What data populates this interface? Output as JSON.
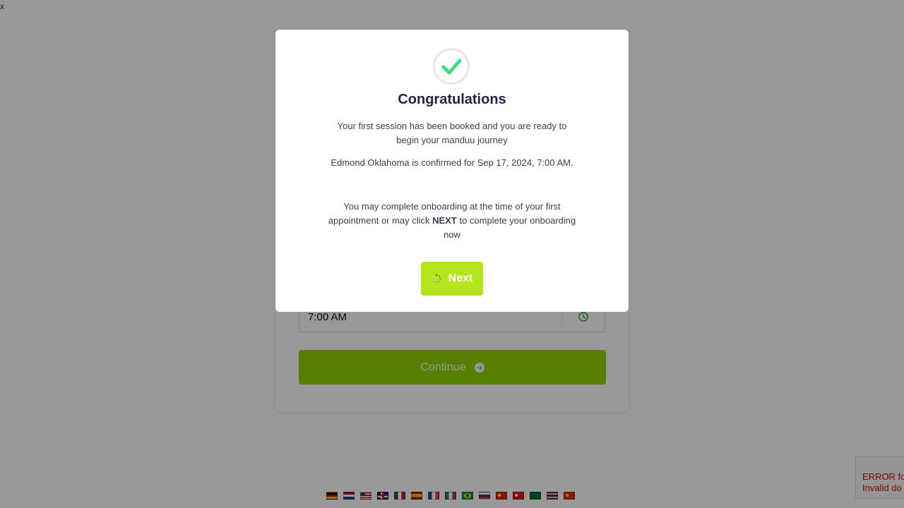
{
  "page": {
    "close_label": "x"
  },
  "form": {
    "time_value": "7:00 AM",
    "continue_label": "Continue"
  },
  "modal": {
    "title": "Congratulations",
    "message1": "Your first session has been booked and you are ready to begin your manduu journey",
    "message2": "Edmond Oklahoma is confirmed for Sep 17, 2024, 7:00 AM.",
    "message3_before": "You may complete onboarding at the time of your first appointment or may click ",
    "message3_bold": "NEXT",
    "message3_after": " to complete your onboarding now",
    "next_label": "Next"
  },
  "recaptcha": {
    "line1": "ERROR fo",
    "line2": "Invalid do"
  },
  "flags": [
    {
      "name": "flag-de",
      "colors": [
        "#000000",
        "#dd0000",
        "#ffce00"
      ],
      "style": "h3"
    },
    {
      "name": "flag-nl",
      "colors": [
        "#ae1c28",
        "#ffffff",
        "#21468b"
      ],
      "style": "h3"
    },
    {
      "name": "flag-us",
      "colors": [
        "#b22234",
        "#ffffff",
        "#3c3b6e"
      ],
      "style": "us"
    },
    {
      "name": "flag-gb",
      "colors": [
        "#012169",
        "#ffffff",
        "#c8102e"
      ],
      "style": "gb"
    },
    {
      "name": "flag-mx",
      "colors": [
        "#006847",
        "#ffffff",
        "#ce1126"
      ],
      "style": "v3"
    },
    {
      "name": "flag-es",
      "colors": [
        "#aa151b",
        "#f1bf00",
        "#aa151b"
      ],
      "style": "es"
    },
    {
      "name": "flag-fr",
      "colors": [
        "#0055a4",
        "#ffffff",
        "#ef4135"
      ],
      "style": "v3"
    },
    {
      "name": "flag-it",
      "colors": [
        "#009246",
        "#ffffff",
        "#ce2b37"
      ],
      "style": "v3"
    },
    {
      "name": "flag-br",
      "colors": [
        "#009c3b",
        "#ffdf00",
        "#002776"
      ],
      "style": "br"
    },
    {
      "name": "flag-ru",
      "colors": [
        "#ffffff",
        "#0039a6",
        "#d52b1e"
      ],
      "style": "h3"
    },
    {
      "name": "flag-vn",
      "colors": [
        "#da251d",
        "#ffff00",
        "#da251d"
      ],
      "style": "star"
    },
    {
      "name": "flag-tr",
      "colors": [
        "#e30a17",
        "#ffffff",
        "#e30a17"
      ],
      "style": "star"
    },
    {
      "name": "flag-sa",
      "colors": [
        "#006c35",
        "#ffffff",
        "#006c35"
      ],
      "style": "solid"
    },
    {
      "name": "flag-th",
      "colors": [
        "#a51931",
        "#f4f5f8",
        "#2d2a4a"
      ],
      "style": "th"
    },
    {
      "name": "flag-cn",
      "colors": [
        "#de2910",
        "#ffde00",
        "#de2910"
      ],
      "style": "star"
    }
  ],
  "colors": {
    "accent_green": "#8fd400",
    "next_green": "#b5e61d",
    "check_green": "#3ddc84"
  }
}
